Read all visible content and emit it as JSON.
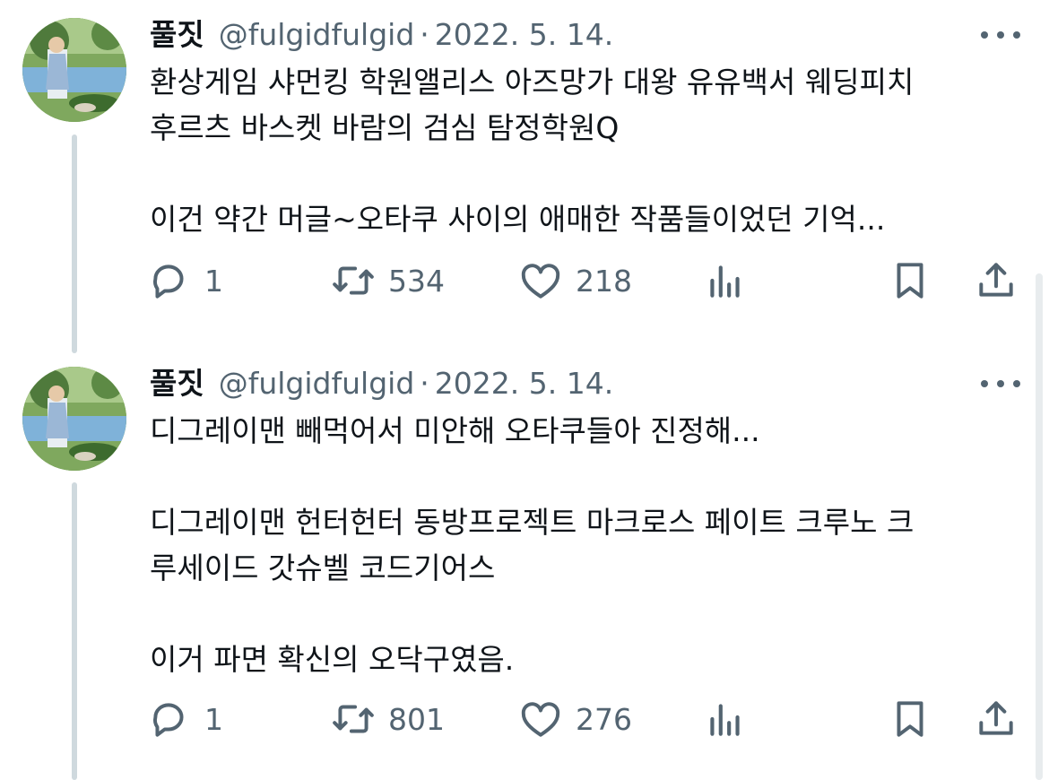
{
  "tweets": [
    {
      "author": {
        "name": "풀짓",
        "handle": "@fulgidfulgid"
      },
      "separator": "·",
      "date": "2022. 5. 14.",
      "lines": [
        "환상게임 샤먼킹 학원앨리스 아즈망가 대왕 유유백서 웨딩피치",
        "후르츠 바스켓 바람의 검심 탐정학원Q",
        "",
        "이건 약간 머글~오타쿠 사이의 애매한 작품들이었던 기억..."
      ],
      "stats": {
        "replies": "1",
        "retweets": "534",
        "likes": "218"
      }
    },
    {
      "author": {
        "name": "풀짓",
        "handle": "@fulgidfulgid"
      },
      "separator": "·",
      "date": "2022. 5. 14.",
      "lines": [
        "디그레이맨 빼먹어서 미안해 오타쿠들아 진정해...",
        "",
        "디그레이맨 헌터헌터 동방프로젝트 마크로스 페이트 크루노 크",
        "루세이드 갓슈벨 코드기어스",
        "",
        "이거 파면 확신의 오닥구였음."
      ],
      "stats": {
        "replies": "1",
        "retweets": "801",
        "likes": "276"
      }
    }
  ],
  "icons": {
    "more": "more-horizontal-icon",
    "reply": "reply-icon",
    "retweet": "retweet-icon",
    "like": "heart-icon",
    "views": "analytics-icon",
    "bookmark": "bookmark-icon",
    "share": "share-icon"
  },
  "colors": {
    "text": "#0f1419",
    "secondary": "#536471",
    "thread_line": "#cfd9de"
  }
}
